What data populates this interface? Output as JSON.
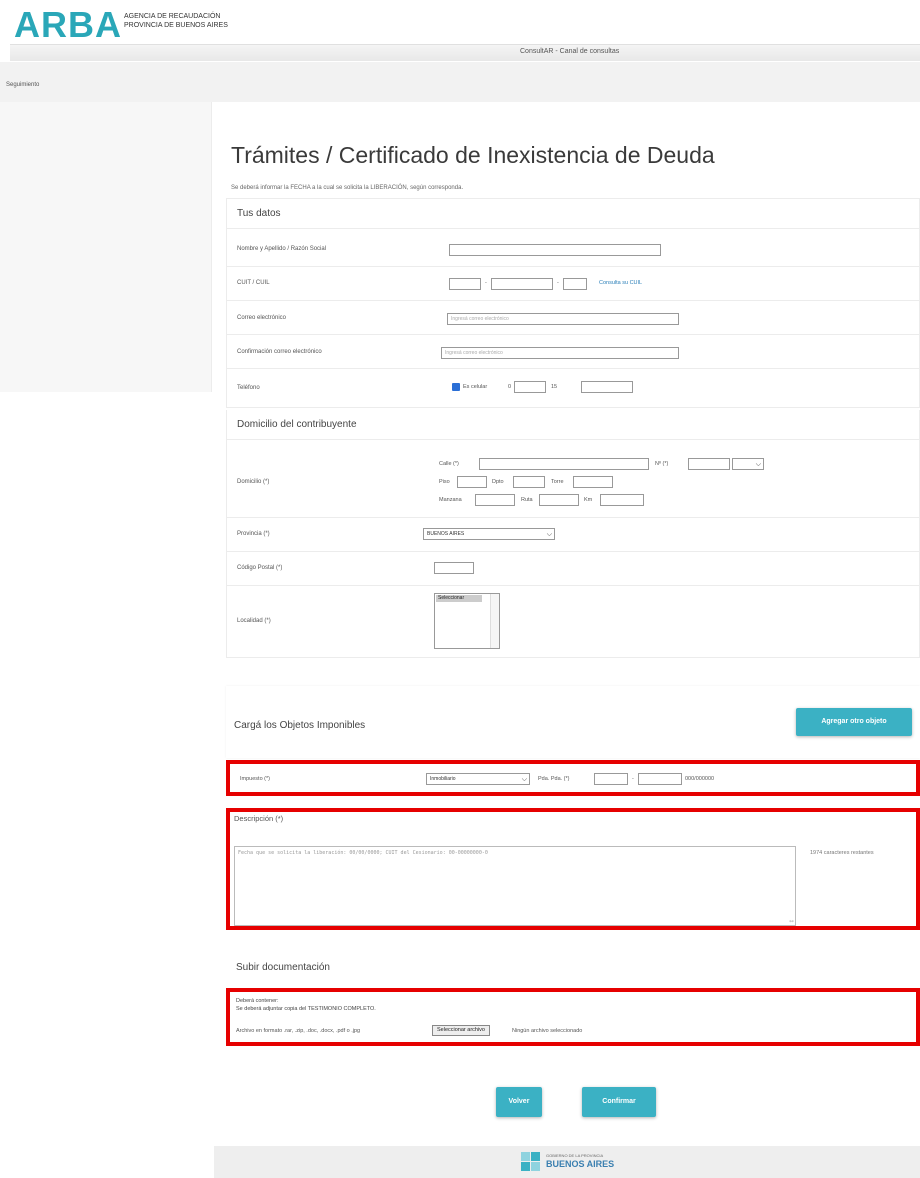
{
  "header": {
    "logo": "ARBA",
    "logo_sub_1": "AGENCIA DE RECAUDACIÓN",
    "logo_sub_2": "PROVINCIA DE BUENOS AIRES",
    "topbar_title": "ConsultAR - Canal de consultas",
    "nav_link": "Seguimiento"
  },
  "page": {
    "title": "Trámites / Certificado de Inexistencia de Deuda",
    "subtitle": "Se deberá informar la FECHA a la cual se solicita la LIBERACIÓN, según corresponda."
  },
  "tus_datos": {
    "heading": "Tus datos",
    "nombre_label": "Nombre y Apellido / Razón Social",
    "cuit_label": "CUIT / CUIL",
    "cuit_link": "Consulta su CUIL",
    "correo_label": "Correo electrónico",
    "correo_placeholder": "Ingresá correo electrónico",
    "confirmacion_label": "Confirmación correo electrónico",
    "confirmacion_placeholder": "Ingresá correo electrónico",
    "telefono_label": "Teléfono",
    "es_celular": "Es celular",
    "prefijo_0": "0",
    "prefijo_15": "15"
  },
  "domicilio": {
    "heading": "Domicilio del contribuyente",
    "domicilio_label": "Domicilio (*)",
    "calle": "Calle (*)",
    "numero": "Nº (*)",
    "piso": "Piso",
    "dpto": "Dpto",
    "torre": "Torre",
    "manzana": "Manzana",
    "ruta": "Ruta",
    "km": "Km",
    "provincia_label": "Provincia (*)",
    "provincia_value": "BUENOS AIRES",
    "cp_label": "Código Postal (*)",
    "localidad_label": "Localidad (*)",
    "localidad_option": "Seleccionar"
  },
  "objetos": {
    "heading": "Cargá los Objetos Imponibles",
    "add_button": "Agregar otro objeto",
    "impuesto_label": "Impuesto (*)",
    "impuesto_value": "Inmobiliario",
    "partida_label": "Pda. Pda. (*)",
    "partida_hint": "000/000000"
  },
  "descripcion": {
    "label": "Descripción (*)",
    "placeholder": "Fecha que se solicita la liberación: 00/00/0000; CUIT del Cesionario: 00-00000000-0",
    "counter": "1974 caracteres restantes"
  },
  "documentacion": {
    "heading": "Subir documentación",
    "deberá": "Deberá contener:",
    "requisito": "Se deberá adjuntar copia del TESTIMONIO COMPLETO.",
    "formatos": "Archivo en formato .rar, .zip, .doc, .docx, .pdf o .jpg",
    "file_button": "Seleccionar archivo",
    "file_status": "Ningún archivo seleccionado"
  },
  "actions": {
    "volver": "Volver",
    "confirmar": "Confirmar"
  },
  "footer": {
    "gov_small": "GOBIERNO DE LA PROVINCIA",
    "gov_big": "BUENOS AIRES"
  },
  "colors": {
    "accent": "#3bb1c4",
    "logo": "#2aa7b8",
    "highlight": "#e60000"
  }
}
